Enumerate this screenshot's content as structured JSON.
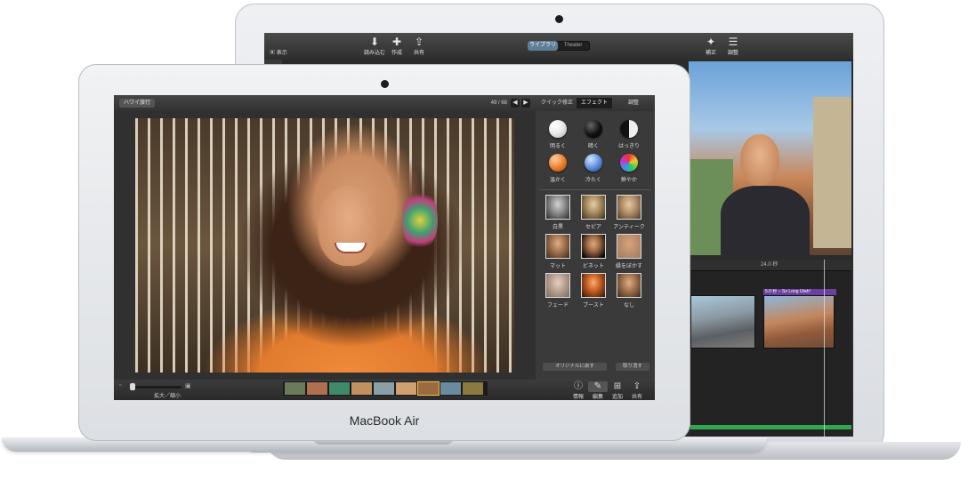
{
  "back_app": {
    "toolbar": {
      "view_label": "表示",
      "import_label": "読み込む",
      "create_label": "作成",
      "share_label": "共有",
      "library_tab": "ライブラリ",
      "theater_tab": "Theater",
      "enhance_label": "補正",
      "adjust_label": "調整"
    },
    "timeline": {
      "ruler_time": "24.0 秒",
      "title_clip_label": "5.0 秒 – So Long Utah!"
    }
  },
  "front_app": {
    "album_back_button": "ハワイ旅行",
    "photo_counter": "49 / 68",
    "tabs": [
      "クイック修正",
      "エフェクト",
      "調整"
    ],
    "selected_tab": "エフェクト",
    "effects": [
      {
        "label": "明るく",
        "color": "#e8e8e8"
      },
      {
        "label": "暗く",
        "color": "#111111"
      },
      {
        "label": "はっきり",
        "color": "#9a9a9a"
      },
      {
        "label": "温かく",
        "color": "#e87a2a"
      },
      {
        "label": "冷たく",
        "color": "#5a8ad8"
      },
      {
        "label": "鮮やか",
        "color": "#d03a9a"
      }
    ],
    "photo_filters": [
      {
        "label": "白黒",
        "kind": "bw"
      },
      {
        "label": "セピア",
        "kind": "sepia"
      },
      {
        "label": "アンティーク",
        "kind": "ant"
      },
      {
        "label": "マット",
        "kind": "none"
      },
      {
        "label": "ビネット",
        "kind": "vig"
      },
      {
        "label": "縁をぼかす",
        "kind": "blur"
      },
      {
        "label": "フェード",
        "kind": "fade"
      },
      {
        "label": "ブースト",
        "kind": "boost"
      },
      {
        "label": "なし",
        "kind": "none"
      }
    ],
    "revert_button": "オリジナルに戻す",
    "undo_button": "取り消す",
    "zoom_label": "拡大／縮小",
    "bottom_buttons": [
      {
        "label": "情報",
        "icon": "info-icon"
      },
      {
        "label": "編集",
        "icon": "pencil-icon"
      },
      {
        "label": "追加",
        "icon": "add-icon"
      },
      {
        "label": "共有",
        "icon": "share-icon"
      }
    ]
  },
  "brand": "MacBook Air"
}
